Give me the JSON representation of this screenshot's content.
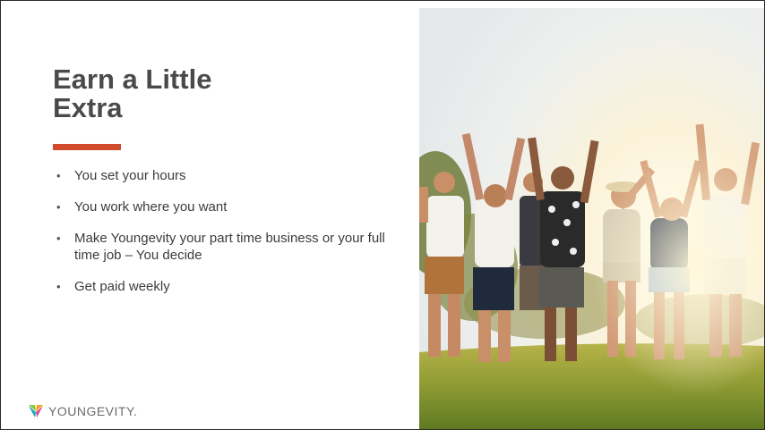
{
  "slide": {
    "title_lines": [
      "Earn a Little",
      "Extra"
    ],
    "bullets": [
      "You set your hours",
      "You work where you want",
      "Make Youngevity your part time business or your full time job – You decide",
      "Get paid weekly"
    ],
    "bullet_glyph": "•",
    "accent_color": "#d04a2c",
    "logo_text": "YOUNGEVITY."
  },
  "photo": {
    "description_icon": "group-celebrating-photo"
  }
}
